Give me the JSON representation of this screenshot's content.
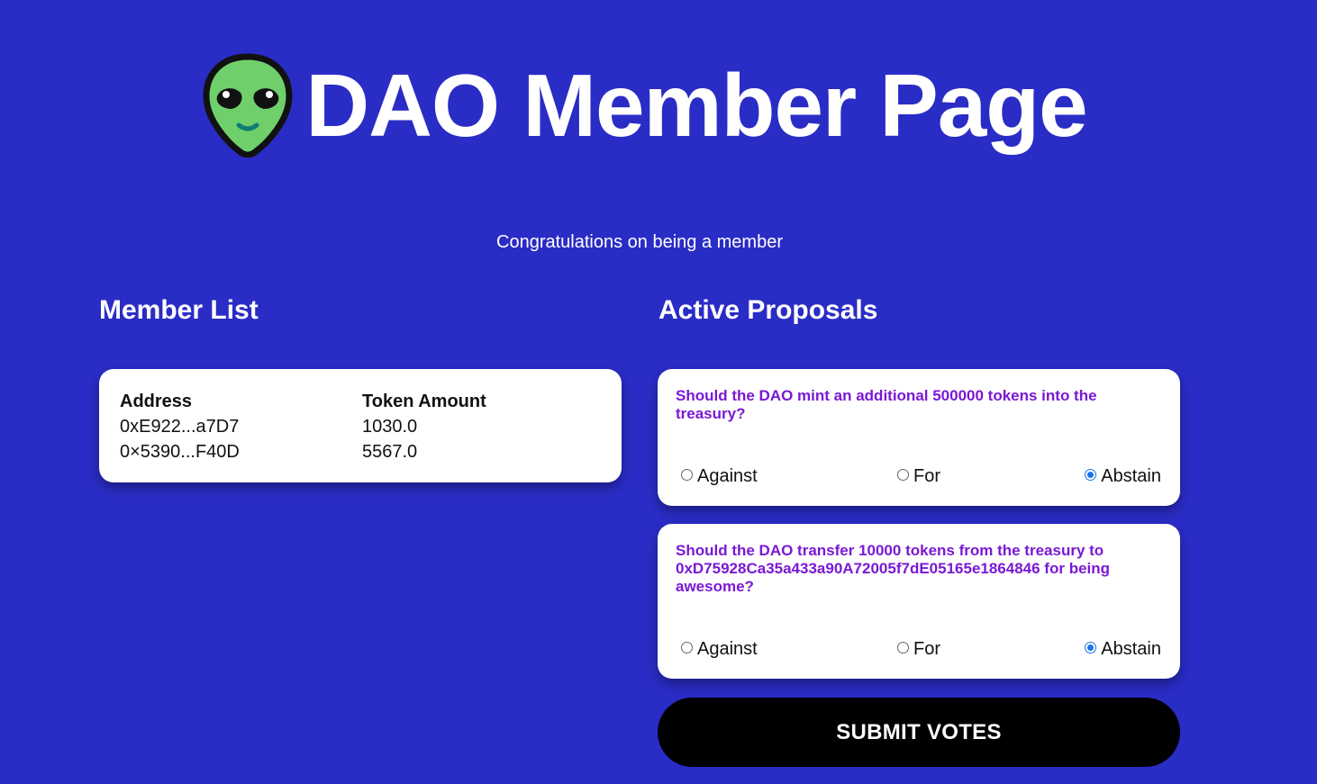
{
  "header": {
    "icon": "alien-icon",
    "title": "DAO Member Page"
  },
  "subtitle": "Congratulations on being a member",
  "members": {
    "heading": "Member List",
    "columns": [
      "Address",
      "Token Amount"
    ],
    "rows": [
      [
        "0xE922...a7D7",
        "1030.0"
      ],
      [
        "0×5390...F40D",
        "5567.0"
      ]
    ]
  },
  "proposals": {
    "heading": "Active Proposals",
    "items": [
      {
        "question": "Should the DAO mint an additional 500000 tokens into the treasury?",
        "options": [
          "Against",
          "For",
          "Abstain"
        ],
        "selected": "Abstain"
      },
      {
        "question": "Should the DAO transfer 10000 tokens from the treasury to 0xD75928Ca35a433a90A72005f7dE05165e1864846 for being awesome?",
        "options": [
          "Against",
          "For",
          "Abstain"
        ],
        "selected": "Abstain"
      }
    ]
  },
  "submit_label": "SUBMIT VOTES",
  "colors": {
    "background": "#2a2cc6",
    "proposal_text": "#7a18d4",
    "radio_selected": "#1a73e8",
    "button": "#000000"
  }
}
